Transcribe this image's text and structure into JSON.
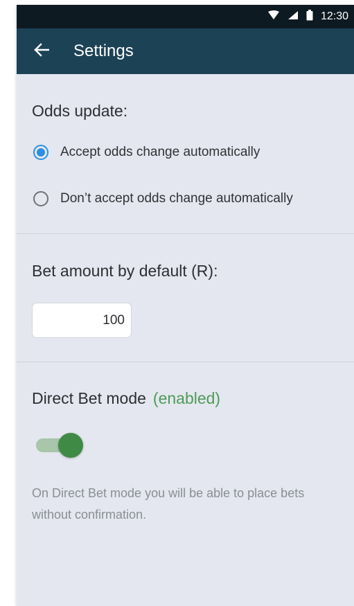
{
  "status_bar": {
    "time": "12:30",
    "icons": [
      "wifi-icon",
      "signal-icon",
      "battery-icon"
    ]
  },
  "app_bar": {
    "back_icon": "arrow-left-icon",
    "title": "Settings"
  },
  "odds_section": {
    "title": "Odds update:",
    "options": [
      {
        "label": "Accept odds change automatically",
        "selected": true
      },
      {
        "label": "Don’t accept odds change automatically",
        "selected": false
      }
    ]
  },
  "bet_amount_section": {
    "title": "Bet amount by default (R):",
    "value": "100"
  },
  "direct_bet_section": {
    "title": "Direct Bet mode",
    "status": "(enabled)",
    "toggle_on": true,
    "description": "On Direct Bet mode you will be able to place bets without confirmation."
  },
  "colors": {
    "status_bar": "#0e1a22",
    "app_bar": "#1c4256",
    "background": "#e4e7ef",
    "radio_accent": "#2c8fe0",
    "enabled_green": "#4e9a58",
    "toggle_knob": "#3f8a45",
    "toggle_track": "#a7c6aa"
  }
}
